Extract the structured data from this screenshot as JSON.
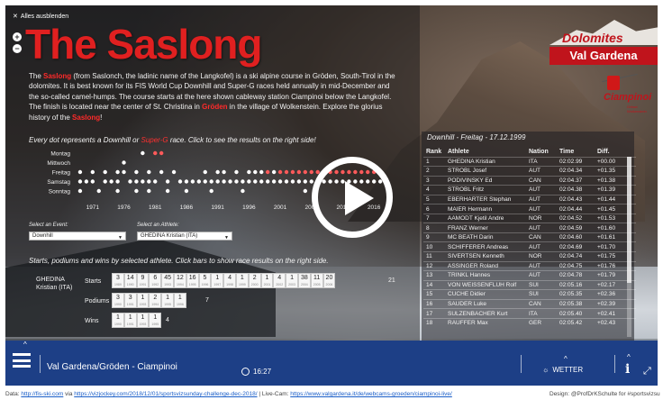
{
  "hide_all_label": "Alles ausblenden",
  "zoom_in": "+",
  "zoom_out": "−",
  "title": "The Saslong",
  "logo": {
    "top": "Dolomites",
    "bottom": "Val Gardena"
  },
  "sponsor": {
    "name": "Ciampinoi",
    "sub": "Ortisei Wolkenstein"
  },
  "intro": {
    "p1": "The ",
    "saslong1": "Saslong",
    "p2": " (from Saslonch, the ladinic name of the Langkofel) is a ski alpine course in Gröden, South-Tirol in the dolomites. It is best known for its FIS World Cup Downhill and Super-G races held annually in mid-December and the so-called camel-humps. The course starts at the here shown cableway station Ciampinoi below the Langkofel. The finish is located near the center of St. Christina in ",
    "groeden": "Gröden",
    "p3": " in the village of Wolkenstein. Explore the glorius history of the ",
    "saslong2": "Saslong",
    "p4": "!"
  },
  "dot_caption": {
    "a": "Every dot represents a Downhill or ",
    "b": "Super-G",
    "c": " race. Click to see the results on the right side!"
  },
  "colors": {
    "accent": "#e02020",
    "bar": "#1d3f86",
    "dot_default": "#ffffff",
    "dot_highlight": "#ff5a5a"
  },
  "chart_data": {
    "type": "scatter",
    "title": "",
    "xlabel": "",
    "ylabel": "",
    "categories": [
      "Montag",
      "Mittwoch",
      "Freitag",
      "Samstag",
      "Sonntag"
    ],
    "x_ticks": [
      "1971",
      "1976",
      "1981",
      "1986",
      "1991",
      "1996",
      "2001",
      "2006",
      "2011",
      "2016"
    ],
    "xlim": [
      1968,
      2019
    ],
    "series": [
      {
        "day": "Montag",
        "points": [
          [
            1979,
            "w"
          ],
          [
            1981,
            "r"
          ],
          [
            1982,
            "r"
          ]
        ]
      },
      {
        "day": "Mittwoch",
        "points": [
          [
            1976,
            "w"
          ]
        ]
      },
      {
        "day": "Freitag",
        "points": [
          [
            1969,
            "w"
          ],
          [
            1971,
            "w"
          ],
          [
            1973,
            "w"
          ],
          [
            1975,
            "w"
          ],
          [
            1976,
            "w"
          ],
          [
            1978,
            "w"
          ],
          [
            1980,
            "w"
          ],
          [
            1982,
            "w"
          ],
          [
            1984,
            "w"
          ],
          [
            1989,
            "w"
          ],
          [
            1991,
            "w"
          ],
          [
            1992,
            "w"
          ],
          [
            1994,
            "w"
          ],
          [
            1996,
            "w"
          ],
          [
            1997,
            "w"
          ],
          [
            1998,
            "w"
          ],
          [
            1999,
            "r"
          ],
          [
            2000,
            "w"
          ],
          [
            2001,
            "r"
          ],
          [
            2002,
            "r"
          ],
          [
            2003,
            "r"
          ],
          [
            2004,
            "r"
          ],
          [
            2005,
            "r"
          ],
          [
            2006,
            "r"
          ],
          [
            2007,
            "r"
          ],
          [
            2008,
            "r"
          ],
          [
            2009,
            "r"
          ],
          [
            2010,
            "r"
          ],
          [
            2011,
            "r"
          ],
          [
            2012,
            "r"
          ],
          [
            2013,
            "r"
          ],
          [
            2014,
            "r"
          ],
          [
            2015,
            "r"
          ],
          [
            2016,
            "r"
          ],
          [
            2017,
            "r"
          ]
        ]
      },
      {
        "day": "Samstag",
        "points": [
          [
            1969,
            "w"
          ],
          [
            1970,
            "w"
          ],
          [
            1971,
            "w"
          ],
          [
            1973,
            "w"
          ],
          [
            1974,
            "w"
          ],
          [
            1975,
            "w"
          ],
          [
            1977,
            "w"
          ],
          [
            1978,
            "w"
          ],
          [
            1979,
            "w"
          ],
          [
            1980,
            "w"
          ],
          [
            1981,
            "w"
          ],
          [
            1983,
            "w"
          ],
          [
            1985,
            "w"
          ],
          [
            1986,
            "w"
          ],
          [
            1987,
            "w"
          ],
          [
            1988,
            "w"
          ],
          [
            1989,
            "w"
          ],
          [
            1990,
            "w"
          ],
          [
            1991,
            "w"
          ],
          [
            1992,
            "w"
          ],
          [
            1993,
            "w"
          ],
          [
            1994,
            "w"
          ],
          [
            1995,
            "w"
          ],
          [
            1996,
            "w"
          ],
          [
            1997,
            "w"
          ],
          [
            1998,
            "w"
          ],
          [
            1999,
            "w"
          ],
          [
            2000,
            "w"
          ],
          [
            2001,
            "w"
          ],
          [
            2002,
            "w"
          ],
          [
            2003,
            "w"
          ],
          [
            2004,
            "w"
          ],
          [
            2005,
            "w"
          ],
          [
            2006,
            "w"
          ],
          [
            2007,
            "w"
          ],
          [
            2008,
            "w"
          ],
          [
            2009,
            "w"
          ],
          [
            2010,
            "w"
          ],
          [
            2011,
            "w"
          ],
          [
            2012,
            "w"
          ],
          [
            2013,
            "w"
          ],
          [
            2014,
            "w"
          ],
          [
            2015,
            "w"
          ],
          [
            2016,
            "w"
          ],
          [
            2017,
            "w"
          ]
        ]
      },
      {
        "day": "Sonntag",
        "points": [
          [
            1969,
            "w"
          ],
          [
            1972,
            "w"
          ],
          [
            1975,
            "w"
          ],
          [
            1978,
            "w"
          ],
          [
            1980,
            "w"
          ],
          [
            1983,
            "w"
          ],
          [
            1986,
            "w"
          ],
          [
            1990,
            "w"
          ],
          [
            1995,
            "w"
          ],
          [
            2005,
            "w"
          ]
        ]
      }
    ]
  },
  "selectors": {
    "event_label": "Select an Event:",
    "event_value": "Downhill",
    "athlete_label": "Select an Athlete:",
    "athlete_value": "GHEDINA Kristian (ITA)"
  },
  "starts_caption": "Starts, podiums and wins by selected athlete. Click bars to show race results on the right side.",
  "athlete_block": {
    "name_line1": "GHEDINA",
    "name_line2": "Kristian (ITA)",
    "starts_label": "Starts",
    "podiums_label": "Podiums",
    "wins_label": "Wins",
    "starts": [
      {
        "v": "3",
        "y": "1989"
      },
      {
        "v": "14",
        "y": "1990"
      },
      {
        "v": "9",
        "y": "1991"
      },
      {
        "v": "6",
        "y": "1992"
      },
      {
        "v": "45",
        "y": "1993"
      },
      {
        "v": "12",
        "y": "1994"
      },
      {
        "v": "16",
        "y": "1995"
      },
      {
        "v": "5",
        "y": "1996"
      },
      {
        "v": "1",
        "y": "1997"
      },
      {
        "v": "4",
        "y": "1998"
      },
      {
        "v": "1",
        "y": "1999"
      },
      {
        "v": "2",
        "y": "2000"
      },
      {
        "v": "1",
        "y": "2001"
      },
      {
        "v": "4",
        "y": "2002"
      },
      {
        "v": "1",
        "y": "2003"
      },
      {
        "v": "38",
        "y": "2004"
      },
      {
        "v": "11",
        "y": "2005"
      },
      {
        "v": "20",
        "y": "2006"
      }
    ],
    "starts_total": "21",
    "podiums": [
      {
        "v": "3",
        "y": "1990"
      },
      {
        "v": "3",
        "y": "1991"
      },
      {
        "v": "1",
        "y": "1993"
      },
      {
        "v": "2",
        "y": "1994"
      },
      {
        "v": "1",
        "y": "1995"
      },
      {
        "v": "1",
        "y": "1996"
      }
    ],
    "podiums_total": "7",
    "wins": [
      {
        "v": "1",
        "y": "1990"
      },
      {
        "v": "1",
        "y": "1991"
      },
      {
        "v": "1",
        "y": "1993"
      },
      {
        "v": "1",
        "y": "1995"
      }
    ],
    "wins_total": "4"
  },
  "race": {
    "title": "Downhill - Freitag - 17.12.1999",
    "headers": [
      "Rank",
      "Athlete",
      "Nation",
      "Time",
      "Diff."
    ],
    "rows": [
      [
        "1",
        "GHEDINA Kristian",
        "ITA",
        "02:02.99",
        "+00.00"
      ],
      [
        "2",
        "STROBL Josef",
        "AUT",
        "02:04.34",
        "+01.35"
      ],
      [
        "3",
        "PODIVINSKY Ed",
        "CAN",
        "02:04.37",
        "+01.38"
      ],
      [
        "4",
        "STROBL Fritz",
        "AUT",
        "02:04.38",
        "+01.39"
      ],
      [
        "5",
        "EBERHARTER Stephan",
        "AUT",
        "02:04.43",
        "+01.44"
      ],
      [
        "6",
        "MAIER Hermann",
        "AUT",
        "02:04.44",
        "+01.45"
      ],
      [
        "7",
        "AAMODT Kjetil Andre",
        "NOR",
        "02:04.52",
        "+01.53"
      ],
      [
        "8",
        "FRANZ Werner",
        "AUT",
        "02:04.59",
        "+01.60"
      ],
      [
        "9",
        "MC BEATH Darin",
        "CAN",
        "02:04.60",
        "+01.61"
      ],
      [
        "10",
        "SCHIFFERER Andreas",
        "AUT",
        "02:04.69",
        "+01.70"
      ],
      [
        "11",
        "SIVERTSEN Kenneth",
        "NOR",
        "02:04.74",
        "+01.75"
      ],
      [
        "12",
        "ASSINGER Roland",
        "AUT",
        "02:04.75",
        "+01.76"
      ],
      [
        "13",
        "TRINKL Hannes",
        "AUT",
        "02:04.78",
        "+01.79"
      ],
      [
        "14",
        "VON WEISSENFLUH Rolf",
        "SUI",
        "02:05.16",
        "+02.17"
      ],
      [
        "15",
        "CUCHE Didier",
        "SUI",
        "02:05.35",
        "+02.36"
      ],
      [
        "16",
        "SAUDER Luke",
        "CAN",
        "02:05.38",
        "+02.39"
      ],
      [
        "17",
        "SULZENBACHER Kurt",
        "ITA",
        "02:05.40",
        "+02.41"
      ],
      [
        "18",
        "RAUFFER Max",
        "GER",
        "02:05.42",
        "+02.43"
      ]
    ]
  },
  "bottombar": {
    "camera": "Val Gardena/Gröden - Ciampinoi",
    "time": "16:27",
    "weather": "WETTER",
    "info": "i"
  },
  "footer": {
    "data_label": "Data: ",
    "link1": "http://fis-ski.com",
    "via": " via ",
    "link2": "https://vizjockey.com/2018/12/01/sportsvizsunday-challenge-dec-2018/",
    "livecam": " | Live-Cam: ",
    "link3": "https://www.valgardena.it/de/webcams-groeden/ciampinoi-live/",
    "design": "Design: @ProfDrKSchulte for #sportsvizsu"
  }
}
